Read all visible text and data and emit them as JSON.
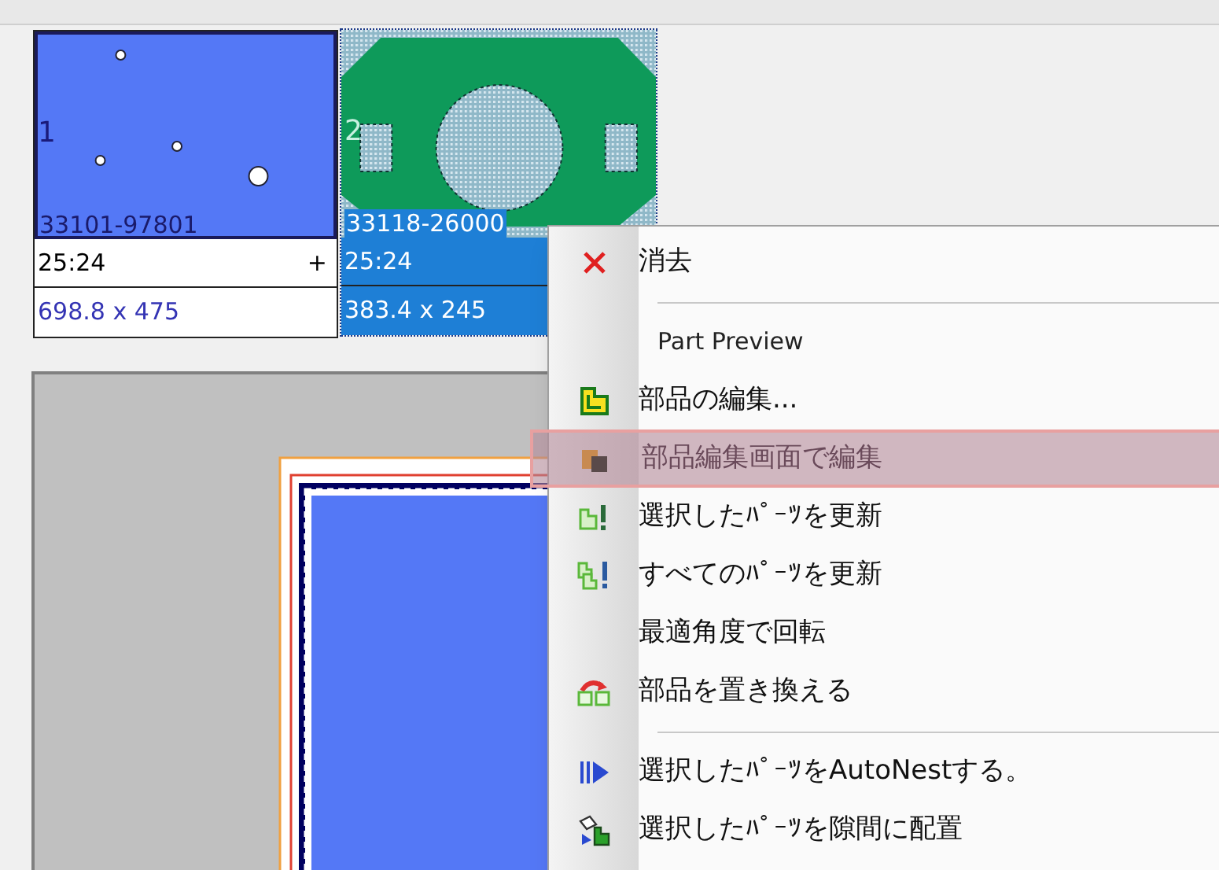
{
  "parts": [
    {
      "number": "1",
      "part_no": "33101-97801",
      "ratio": "25:24",
      "plus": "+",
      "size": "698.8 x 475",
      "selected": false
    },
    {
      "number": "2",
      "part_no": "33118-26000",
      "ratio": "25:24",
      "size": "383.4 x 245",
      "selected": true
    }
  ],
  "context_menu": {
    "items": [
      {
        "kind": "item",
        "label": "消去",
        "selected": false
      },
      {
        "kind": "separator"
      },
      {
        "kind": "header",
        "label": "Part Preview"
      },
      {
        "kind": "item",
        "label": "部品の編集...",
        "selected": false
      },
      {
        "kind": "item",
        "label": "部品編集画面で編集",
        "selected": true
      },
      {
        "kind": "item",
        "label": "選択したﾊﾟｰﾂを更新",
        "selected": false
      },
      {
        "kind": "item",
        "label": "すべてのﾊﾟｰﾂを更新",
        "selected": false
      },
      {
        "kind": "item",
        "label": "最適角度で回転",
        "selected": false
      },
      {
        "kind": "item",
        "label": "部品を置き換える",
        "selected": false
      },
      {
        "kind": "separator"
      },
      {
        "kind": "item",
        "label": "選択したﾊﾟｰﾂをAutoNestする。",
        "selected": false
      },
      {
        "kind": "item",
        "label": "選択したﾊﾟｰﾂを隙間に配置",
        "selected": false
      }
    ]
  }
}
